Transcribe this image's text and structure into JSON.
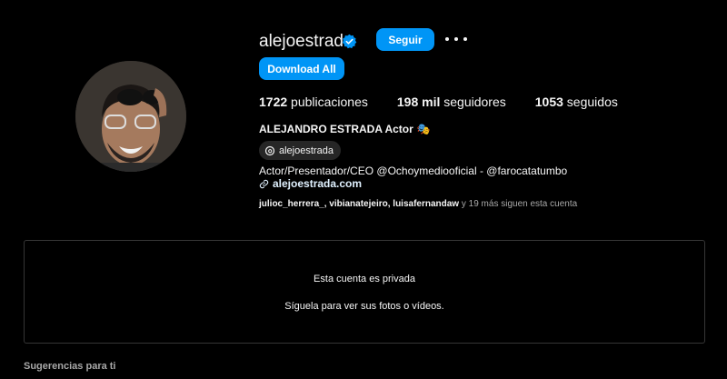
{
  "profile": {
    "username": "alejoestrada",
    "follow_label": "Seguir",
    "download_label": "Download All",
    "avatar_icon": "person-avatar",
    "verified_icon": "verified-badge-icon",
    "accent": "#0095f6"
  },
  "stats": {
    "posts_count": "1722",
    "posts_label": " publicaciones",
    "followers_count": "198 mil",
    "followers_label": " seguidores",
    "following_count": "1053",
    "following_label": " seguidos"
  },
  "bio": {
    "full_name": "ALEJANDRO ESTRADA Actor",
    "emoji": "🎭",
    "threads_handle": "alejoestrada",
    "description": "Actor/Presentador/CEO @Ochoymediooficial - @farocatatumbo",
    "link": "alejoestrada.com"
  },
  "followed_by": {
    "names": "julioc_herrera_, vibianatejeiro, luisafernandaw",
    "suffix": " y 19 más siguen esta cuenta"
  },
  "private": {
    "title": "Esta cuenta es privada",
    "subtitle": "Síguela para ver sus fotos o vídeos."
  },
  "suggestions": {
    "label": "Sugerencias para ti"
  }
}
